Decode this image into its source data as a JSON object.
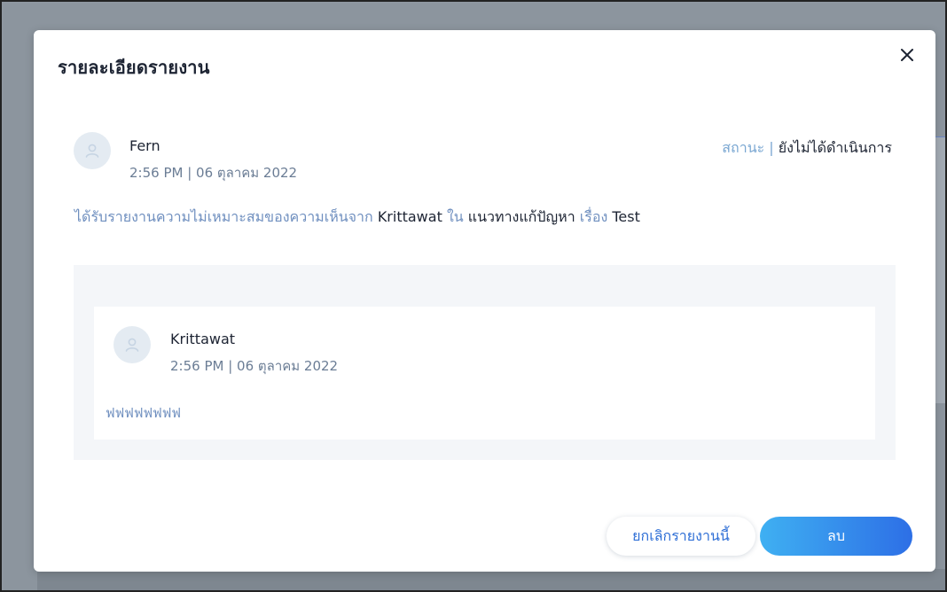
{
  "modal": {
    "title": "รายละเอียดรายงาน"
  },
  "report": {
    "reporter_name": "Fern",
    "reporter_date": "2:56 PM | 06 ตุลาคม 2022",
    "status_label": "สถานะ |",
    "status_value": "ยังไม่ได้ดำเนินการ",
    "message": {
      "prefix": "ได้รับรายงานความไม่เหมาะสมของความเห็นจาก",
      "author": "Krittawat",
      "in_word": "ใน",
      "category": "แนวทางแก้ปัญหา",
      "topic_word": "เรื่อง",
      "topic": "Test"
    }
  },
  "comment": {
    "author": "Krittawat",
    "date": "2:56 PM | 06 ตุลาคม 2022",
    "text": "ฟฟฟฟฟฟฟฟ"
  },
  "actions": {
    "cancel_label": "ยกเลิกรายงานนี้",
    "delete_label": "ลบ"
  },
  "icons": {
    "close": "close-icon",
    "avatar": "user-icon"
  },
  "colors": {
    "primary": "#2d6fe6",
    "primary_light": "#3fb0f2",
    "muted_text": "#6f8fbf",
    "dark_text": "#1d2433",
    "panel_bg": "#f4f6f9",
    "backdrop": "#8e97a0"
  }
}
